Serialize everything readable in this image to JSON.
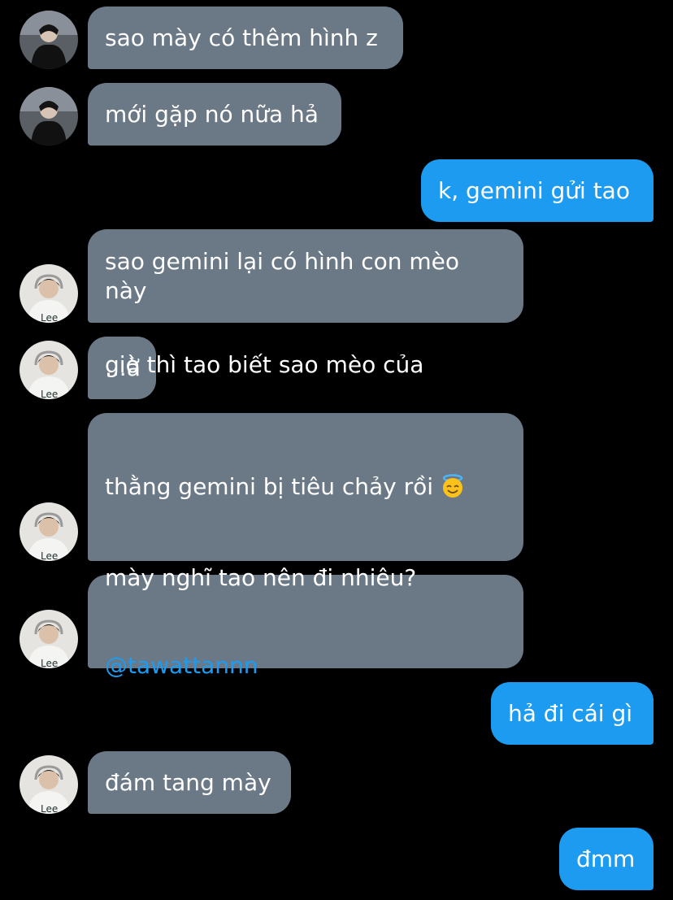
{
  "messages": [
    {
      "side": "in",
      "text": "sao mày có thêm hình z",
      "avatar": "dark-avatar"
    },
    {
      "side": "in",
      "text": "mới gặp nó nữa hả",
      "avatar": "dark-avatar"
    },
    {
      "side": "out",
      "text": "k, gemini gửi tao"
    },
    {
      "side": "in",
      "text": "sao gemini lại có hình con mèo\nnày",
      "avatar": "light-avatar"
    },
    {
      "side": "in",
      "text": "...à",
      "avatar": "light-avatar"
    },
    {
      "side": "in",
      "line1": "giờ thì tao biết sao mèo của",
      "line2": "thằng gemini bị tiêu chảy rồi",
      "emoji": "smiling-face-with-halo",
      "avatar": "light-avatar"
    },
    {
      "side": "in",
      "text": "mày nghĩ tao nên đi nhiêu?",
      "mention": "@tawattannn",
      "avatar": "light-avatar"
    },
    {
      "side": "out",
      "text": "hả đi cái gì"
    },
    {
      "side": "in",
      "text": "đám tang mày",
      "avatar": "light-avatar"
    },
    {
      "side": "out",
      "text": "đmm"
    }
  ],
  "colors": {
    "background": "#000000",
    "incoming_bubble": "#6b7987",
    "outgoing_bubble": "#1d9bf0",
    "mention": "#1d9bf0"
  }
}
